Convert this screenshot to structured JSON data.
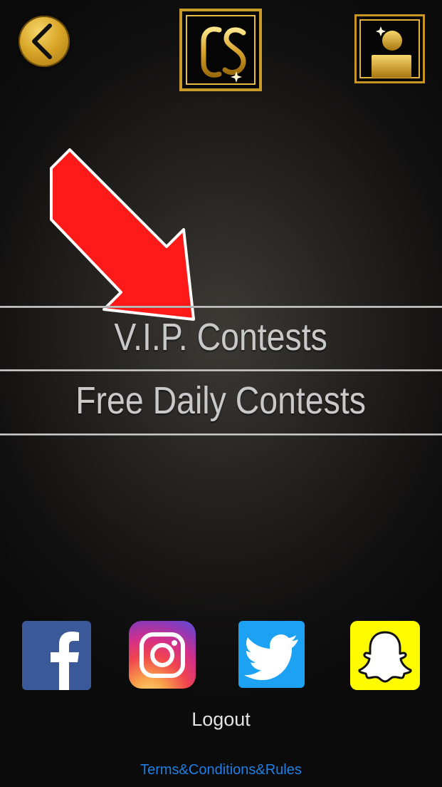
{
  "header": {
    "back_icon": "chevron-left-icon",
    "logo_icon": "cs-logo",
    "profile_icon": "user-icon"
  },
  "annotation": {
    "arrow_icon": "red-arrow-icon",
    "arrow_color": "#ff1a1a"
  },
  "menu": {
    "items": [
      {
        "label": "V.I.P. Contests"
      },
      {
        "label": "Free Daily Contests"
      }
    ]
  },
  "social": {
    "items": [
      {
        "icon": "facebook-icon",
        "color": "#3b5998"
      },
      {
        "icon": "instagram-icon",
        "color": "#d32f8a"
      },
      {
        "icon": "twitter-icon",
        "color": "#1da1f2"
      },
      {
        "icon": "snapchat-icon",
        "color": "#fffc00"
      }
    ]
  },
  "footer": {
    "logout_label": "Logout",
    "terms_label": "Terms&Conditions&Rules"
  },
  "colors": {
    "gold": "#d9a628",
    "link": "#1f7fe6",
    "menu_text": "#c9c9c9"
  }
}
